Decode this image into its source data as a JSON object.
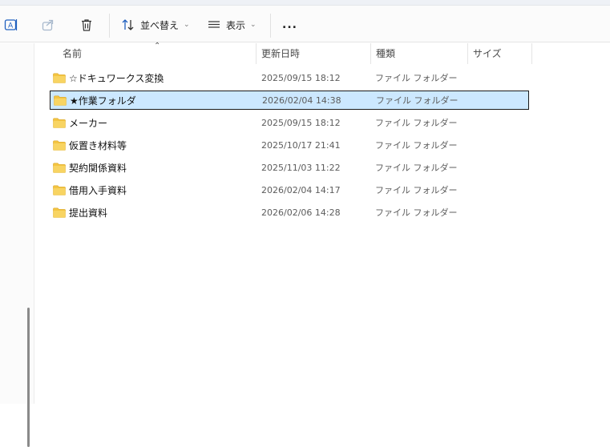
{
  "toolbar": {
    "sort_label": "並べ替え",
    "view_label": "表示",
    "more_label": "..."
  },
  "columns": {
    "name": "名前",
    "date": "更新日時",
    "type": "種類",
    "size": "サイズ"
  },
  "files": [
    {
      "name": "☆ドキュワークス変換",
      "date": "2025/09/15 18:12",
      "type": "ファイル フォルダー",
      "selected": false
    },
    {
      "name": "★作業フォルダ",
      "date": "2026/02/04 14:38",
      "type": "ファイル フォルダー",
      "selected": true
    },
    {
      "name": "メーカー",
      "date": "2025/09/15 18:12",
      "type": "ファイル フォルダー",
      "selected": false
    },
    {
      "name": "仮置き材料等",
      "date": "2025/10/17 21:41",
      "type": "ファイル フォルダー",
      "selected": false
    },
    {
      "name": "契約関係資料",
      "date": "2025/11/03 11:22",
      "type": "ファイル フォルダー",
      "selected": false
    },
    {
      "name": "借用入手資料",
      "date": "2026/02/04 14:17",
      "type": "ファイル フォルダー",
      "selected": false
    },
    {
      "name": "提出資料",
      "date": "2026/02/06 14:28",
      "type": "ファイル フォルダー",
      "selected": false
    }
  ],
  "colors": {
    "selection": "#cce8ff",
    "folder": "#f4c542"
  }
}
